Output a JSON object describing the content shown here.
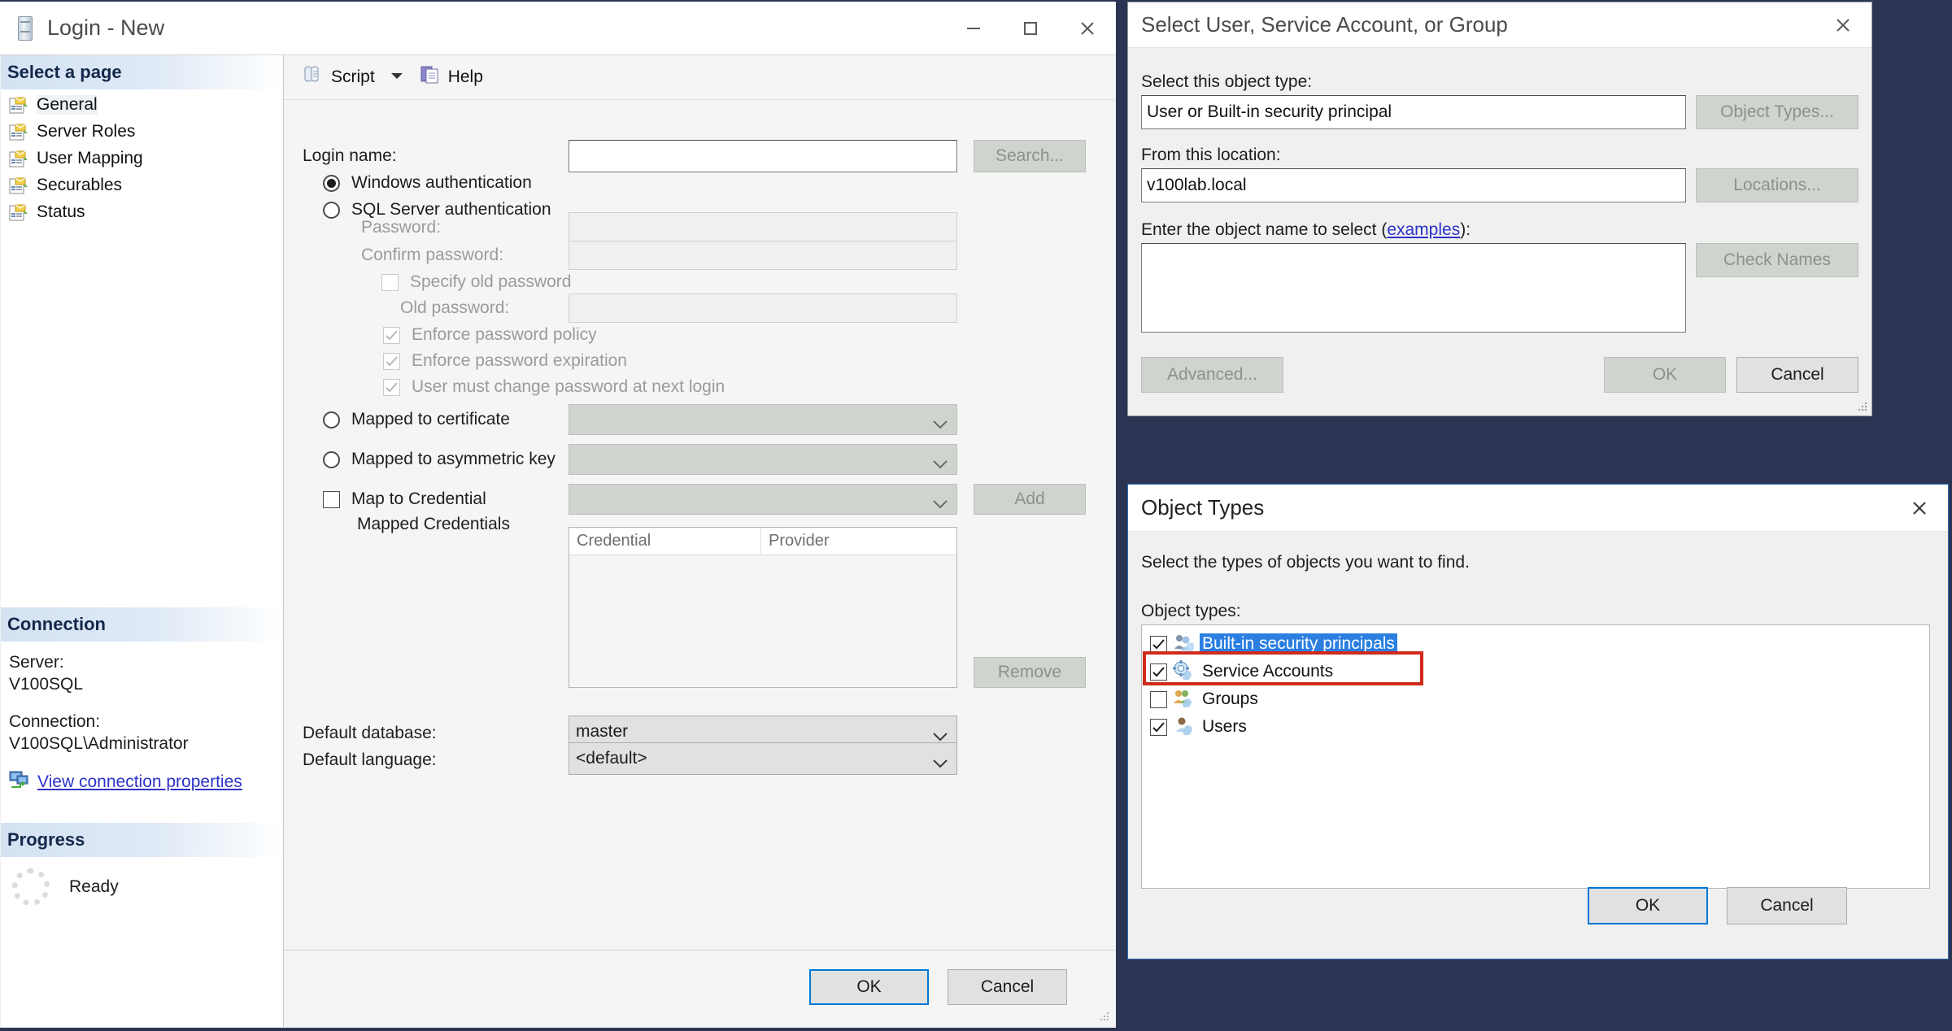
{
  "login_window": {
    "title": "Login - New",
    "window_buttons": {
      "minimize": "minimize-icon",
      "maximize": "maximize-icon",
      "close": "close-icon"
    },
    "sidebar": {
      "select_page_header": "Select a page",
      "pages": [
        {
          "label": "General",
          "selected": true
        },
        {
          "label": "Server Roles",
          "selected": false
        },
        {
          "label": "User Mapping",
          "selected": false
        },
        {
          "label": "Securables",
          "selected": false
        },
        {
          "label": "Status",
          "selected": false
        }
      ],
      "connection_header": "Connection",
      "server_label": "Server:",
      "server_value": "V100SQL",
      "connection_label": "Connection:",
      "connection_value": "V100SQL\\Administrator",
      "view_connection_link": "View connection properties",
      "progress_header": "Progress",
      "progress_status": "Ready"
    },
    "toolbar": {
      "script_label": "Script",
      "script_dropdown": "chevron-down-icon",
      "help_label": "Help"
    },
    "form": {
      "login_name_label": "Login name:",
      "login_name_value": "",
      "search_button": "Search...",
      "windows_auth_label": "Windows authentication",
      "windows_auth_selected": true,
      "sql_auth_label": "SQL Server authentication",
      "sql_auth_selected": false,
      "password_label": "Password:",
      "password_value": "",
      "confirm_password_label": "Confirm password:",
      "confirm_password_value": "",
      "specify_old_password_label": "Specify old password",
      "specify_old_password_checked": false,
      "old_password_label": "Old password:",
      "old_password_value": "",
      "enforce_policy_label": "Enforce password policy",
      "enforce_policy_checked": true,
      "enforce_expiration_label": "Enforce password expiration",
      "enforce_expiration_checked": true,
      "must_change_label": "User must change password at next login",
      "must_change_checked": true,
      "mapped_cert_label": "Mapped to certificate",
      "mapped_cert_selected": false,
      "mapped_cert_value": "",
      "mapped_key_label": "Mapped to asymmetric key",
      "mapped_key_selected": false,
      "mapped_key_value": "",
      "map_credential_label": "Map to Credential",
      "map_credential_checked": false,
      "map_credential_value": "",
      "add_button": "Add",
      "remove_button": "Remove",
      "mapped_credentials_label": "Mapped Credentials",
      "credentials_columns": [
        "Credential",
        "Provider"
      ],
      "credentials_rows": [],
      "default_database_label": "Default database:",
      "default_database_value": "master",
      "default_language_label": "Default language:",
      "default_language_value": "<default>"
    },
    "footer": {
      "ok_button": "OK",
      "cancel_button": "Cancel"
    }
  },
  "select_user_dialog": {
    "title": "Select User, Service Account, or Group",
    "close_icon": "close-icon",
    "object_type_label": "Select this object type:",
    "object_type_value": "User or Built-in security principal",
    "object_types_button": "Object Types...",
    "location_label": "From this location:",
    "location_value": "v100lab.local",
    "locations_button": "Locations...",
    "object_name_label_pre": "Enter the object name to select (",
    "object_name_link": "examples",
    "object_name_label_post": "):",
    "object_name_value": "",
    "check_names_button": "Check Names",
    "advanced_button": "Advanced...",
    "ok_button": "OK",
    "cancel_button": "Cancel"
  },
  "object_types_dialog": {
    "title": "Object Types",
    "close_icon": "close-icon",
    "instruction": "Select the types of objects you want to find.",
    "list_label": "Object types:",
    "items": [
      {
        "label": "Built-in security principals",
        "checked": true,
        "selected": true,
        "highlighted": false,
        "icon": "builtin-security-principals-icon"
      },
      {
        "label": "Service Accounts",
        "checked": true,
        "selected": false,
        "highlighted": true,
        "icon": "service-accounts-icon"
      },
      {
        "label": "Groups",
        "checked": false,
        "selected": false,
        "highlighted": false,
        "icon": "groups-icon"
      },
      {
        "label": "Users",
        "checked": true,
        "selected": false,
        "highlighted": false,
        "icon": "users-icon"
      }
    ],
    "ok_button": "OK",
    "cancel_button": "Cancel"
  },
  "colors": {
    "desktop_background": "#2b3553",
    "accent_blue": "#0078d7",
    "highlight_red": "#cf2a1b",
    "selection_blue": "#2a7fe0",
    "link_blue": "#2b32c9"
  }
}
